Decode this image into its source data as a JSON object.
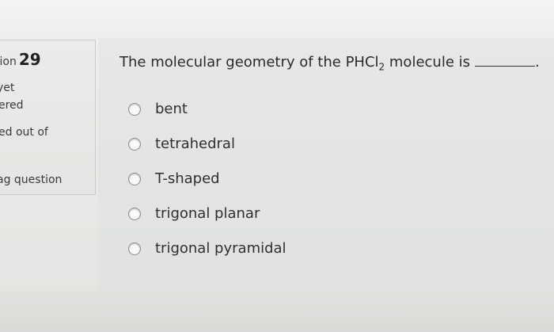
{
  "sidebar": {
    "question_label": "tion",
    "question_number": "29",
    "status_line1": "yet",
    "status_line2": "ered",
    "marks_text": "ed out of",
    "flag_text": "ag question"
  },
  "question": {
    "text_before": "The molecular geometry of the PHCl",
    "subscript": "2",
    "text_after": " molecule is",
    "end_mark": "."
  },
  "options": [
    {
      "label": "bent"
    },
    {
      "label": "tetrahedral"
    },
    {
      "label": "T-shaped"
    },
    {
      "label": "trigonal planar"
    },
    {
      "label": "trigonal pyramidal"
    }
  ]
}
